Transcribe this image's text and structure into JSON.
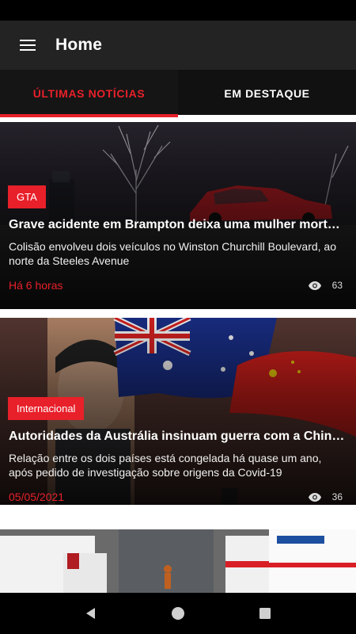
{
  "app": {
    "title": "Home"
  },
  "tabs": [
    {
      "label": "ÚLTIMAS NOTÍCIAS",
      "active": true
    },
    {
      "label": "EM DESTAQUE",
      "active": false
    }
  ],
  "articles": [
    {
      "category": "GTA",
      "headline": "Grave acidente em Brampton deixa uma mulher morta na ...",
      "summary": "Colisão envolveu dois veículos no Winston Churchill Boulevard, ao norte da Steeles Avenue",
      "time": "Há 6 horas",
      "views": "63"
    },
    {
      "category": "Internacional",
      "headline": "Autoridades da Austrália insinuam guerra com a China; m...",
      "summary": "Relação entre os dois países está congelada há quase um ano, após pedido de investigação sobre origens da Covid-19",
      "time": "05/05/2021",
      "views": "36"
    }
  ],
  "colors": {
    "accent": "#e8202a",
    "appbar": "#232323",
    "tabs": "#151515"
  },
  "icons": {
    "menu": "hamburger-menu-icon",
    "views": "eye-icon",
    "back": "back-triangle-icon",
    "home": "home-circle-icon",
    "recents": "recents-square-icon"
  }
}
